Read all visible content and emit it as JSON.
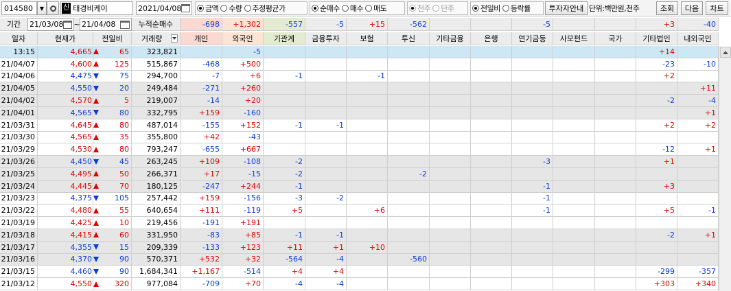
{
  "toolbar": {
    "stock_code": "014580",
    "stock_name": "태경비케이",
    "stock_badge": "신",
    "date": "2021/04/08",
    "mode_options": [
      {
        "label": "금액",
        "selected": true,
        "disabled": false
      },
      {
        "label": "수량",
        "selected": false,
        "disabled": false
      },
      {
        "label": "추정평균가",
        "selected": false,
        "disabled": false
      }
    ],
    "trade_options": [
      {
        "label": "순매수",
        "selected": true,
        "disabled": false
      },
      {
        "label": "매수",
        "selected": false,
        "disabled": false
      },
      {
        "label": "매도",
        "selected": false,
        "disabled": false
      }
    ],
    "unit_options": [
      {
        "label": "천주",
        "selected": true,
        "disabled": true
      },
      {
        "label": "단주",
        "selected": false,
        "disabled": true
      }
    ],
    "compare_options": [
      {
        "label": "전일비",
        "selected": true,
        "disabled": false
      },
      {
        "label": "등락률",
        "selected": false,
        "disabled": false
      }
    ],
    "investor_guide_label": "투자자안내",
    "unit_text": "단위:백만원,천주",
    "query_label": "조회",
    "next_label": "다음",
    "chart_label": "차트"
  },
  "period": {
    "label": "기간",
    "from": "21/03/08",
    "tilde": "~",
    "to": "21/04/08",
    "cumulative_label": "누적순매수",
    "totals": [
      "-698",
      "+1,302",
      "-557",
      "-5",
      "+15",
      "-562",
      "",
      "",
      "-5",
      "",
      "",
      "+3",
      "-40"
    ]
  },
  "columns": [
    "일자",
    "현재가",
    "전일비",
    "거래량",
    "개인",
    "외국인",
    "기관계",
    "금융투자",
    "보험",
    "투신",
    "기타금융",
    "은행",
    "연기금등",
    "사모펀드",
    "국가",
    "기타법인",
    "내외국인"
  ],
  "colors": {
    "up": "#e00000",
    "down": "#0a3ad6",
    "individual_bg": "#fbd9d3",
    "foreign_bg": "#fbe4d3",
    "institution_bg": "#e3ecd0",
    "highlight_row": "#cde7f5",
    "band_row": "#e6e6e6"
  },
  "rows": [
    {
      "date": "13:15",
      "price": "4,665",
      "dir": "up",
      "change": "65",
      "volume": "323,821",
      "vals": [
        "",
        "-5",
        "",
        "",
        "",
        "",
        "",
        "",
        "",
        "",
        "",
        "+14",
        ""
      ],
      "band": "highlight"
    },
    {
      "date": "21/04/07",
      "price": "4,600",
      "dir": "up",
      "change": "125",
      "volume": "515,867",
      "vals": [
        "-468",
        "+500",
        "",
        "",
        "",
        "",
        "",
        "",
        "",
        "",
        "",
        "-23",
        "-10"
      ],
      "band": "white"
    },
    {
      "date": "21/04/06",
      "price": "4,475",
      "dir": "down",
      "change": "75",
      "volume": "294,700",
      "vals": [
        "-7",
        "+6",
        "-1",
        "",
        "-1",
        "",
        "",
        "",
        "",
        "",
        "",
        "+2",
        ""
      ],
      "band": "white"
    },
    {
      "date": "21/04/05",
      "price": "4,550",
      "dir": "down",
      "change": "20",
      "volume": "249,484",
      "vals": [
        "-271",
        "+260",
        "",
        "",
        "",
        "",
        "",
        "",
        "",
        "",
        "",
        "",
        "+11"
      ],
      "band": "gray"
    },
    {
      "date": "21/04/02",
      "price": "4,570",
      "dir": "up",
      "change": "5",
      "volume": "219,007",
      "vals": [
        "-14",
        "+20",
        "",
        "",
        "",
        "",
        "",
        "",
        "",
        "",
        "",
        "-2",
        "-4"
      ],
      "band": "gray"
    },
    {
      "date": "21/04/01",
      "price": "4,565",
      "dir": "down",
      "change": "80",
      "volume": "332,795",
      "vals": [
        "+159",
        "-160",
        "",
        "",
        "",
        "",
        "",
        "",
        "",
        "",
        "",
        "",
        "+1"
      ],
      "band": "gray"
    },
    {
      "date": "21/03/31",
      "price": "4,645",
      "dir": "up",
      "change": "80",
      "volume": "487,014",
      "vals": [
        "-155",
        "+152",
        "-1",
        "-1",
        "",
        "",
        "",
        "",
        "",
        "",
        "",
        "+2",
        "+2"
      ],
      "band": "white"
    },
    {
      "date": "21/03/30",
      "price": "4,565",
      "dir": "up",
      "change": "35",
      "volume": "355,800",
      "vals": [
        "+42",
        "-43",
        "",
        "",
        "",
        "",
        "",
        "",
        "",
        "",
        "",
        "",
        ""
      ],
      "band": "white"
    },
    {
      "date": "21/03/29",
      "price": "4,530",
      "dir": "up",
      "change": "80",
      "volume": "793,247",
      "vals": [
        "-655",
        "+667",
        "",
        "",
        "",
        "",
        "",
        "",
        "",
        "",
        "",
        "-12",
        "+1"
      ],
      "band": "white"
    },
    {
      "date": "21/03/26",
      "price": "4,450",
      "dir": "down",
      "change": "45",
      "volume": "263,245",
      "vals": [
        "+109",
        "-108",
        "-2",
        "",
        "",
        "",
        "",
        "",
        "-3",
        "",
        "",
        "+1",
        ""
      ],
      "band": "gray"
    },
    {
      "date": "21/03/25",
      "price": "4,495",
      "dir": "up",
      "change": "50",
      "volume": "266,371",
      "vals": [
        "+17",
        "-15",
        "-2",
        "",
        "",
        "-2",
        "",
        "",
        "",
        "",
        "",
        "",
        ""
      ],
      "band": "gray"
    },
    {
      "date": "21/03/24",
      "price": "4,445",
      "dir": "up",
      "change": "70",
      "volume": "180,125",
      "vals": [
        "-247",
        "+244",
        "-1",
        "",
        "",
        "",
        "",
        "",
        "-1",
        "",
        "",
        "+3",
        ""
      ],
      "band": "gray"
    },
    {
      "date": "21/03/23",
      "price": "4,375",
      "dir": "down",
      "change": "105",
      "volume": "257,442",
      "vals": [
        "+159",
        "-156",
        "-3",
        "-2",
        "",
        "",
        "",
        "",
        "-1",
        "",
        "",
        "",
        ""
      ],
      "band": "white"
    },
    {
      "date": "21/03/22",
      "price": "4,480",
      "dir": "up",
      "change": "55",
      "volume": "640,654",
      "vals": [
        "+111",
        "-119",
        "+5",
        "",
        "+6",
        "",
        "",
        "",
        "-1",
        "",
        "",
        "+5",
        "-1"
      ],
      "band": "white"
    },
    {
      "date": "21/03/19",
      "price": "4,425",
      "dir": "up",
      "change": "10",
      "volume": "219,456",
      "vals": [
        "-191",
        "+191",
        "",
        "",
        "",
        "",
        "",
        "",
        "",
        "",
        "",
        "",
        ""
      ],
      "band": "white"
    },
    {
      "date": "21/03/18",
      "price": "4,415",
      "dir": "up",
      "change": "60",
      "volume": "331,950",
      "vals": [
        "-83",
        "+85",
        "-1",
        "-1",
        "",
        "",
        "",
        "",
        "",
        "",
        "",
        "-2",
        "+1"
      ],
      "band": "gray"
    },
    {
      "date": "21/03/17",
      "price": "4,355",
      "dir": "down",
      "change": "15",
      "volume": "209,339",
      "vals": [
        "-133",
        "+123",
        "+11",
        "+1",
        "+10",
        "",
        "",
        "",
        "",
        "",
        "",
        "",
        ""
      ],
      "band": "gray"
    },
    {
      "date": "21/03/16",
      "price": "4,370",
      "dir": "down",
      "change": "90",
      "volume": "570,371",
      "vals": [
        "+532",
        "+32",
        "-564",
        "-4",
        "",
        "-560",
        "",
        "",
        "",
        "",
        "",
        "",
        ""
      ],
      "band": "gray"
    },
    {
      "date": "21/03/15",
      "price": "4,460",
      "dir": "down",
      "change": "90",
      "volume": "1,684,341",
      "vals": [
        "+1,167",
        "-514",
        "+4",
        "+4",
        "",
        "",
        "",
        "",
        "",
        "",
        "",
        "-299",
        "-357"
      ],
      "band": "white"
    },
    {
      "date": "21/03/12",
      "price": "4,550",
      "dir": "up",
      "change": "320",
      "volume": "977,084",
      "vals": [
        "-709",
        "+70",
        "-4",
        "-4",
        "",
        "",
        "",
        "",
        "",
        "",
        "",
        "+303",
        "+340"
      ],
      "band": "white"
    }
  ]
}
